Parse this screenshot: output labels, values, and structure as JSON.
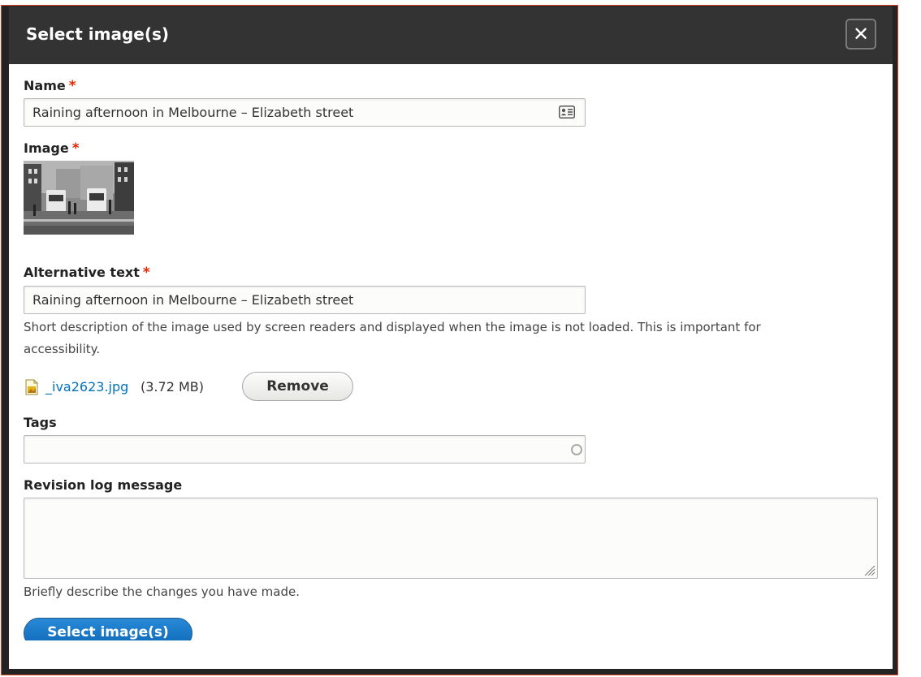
{
  "dialog": {
    "title": "Select image(s)",
    "close_label": "✕"
  },
  "form": {
    "name": {
      "label": "Name",
      "required_marker": "*",
      "value": "Raining afternoon in Melbourne – Elizabeth street"
    },
    "image": {
      "label": "Image",
      "required_marker": "*"
    },
    "alt_text": {
      "label": "Alternative text",
      "required_marker": "*",
      "value": "Raining afternoon in Melbourne – Elizabeth street",
      "description_line1": "Short description of the image used by screen readers and displayed when the image is not loaded. This is important for",
      "description_line2": "accessibility."
    },
    "file": {
      "name": "_iva2623.jpg",
      "size": "(3.72 MB)",
      "remove_label": "Remove"
    },
    "tags": {
      "label": "Tags",
      "value": ""
    },
    "revision": {
      "label": "Revision log message",
      "value": "",
      "description": "Briefly describe the changes you have made."
    },
    "submit_label": "Select image(s)"
  },
  "colors": {
    "titlebar": "#333333",
    "required": "#e62600",
    "link": "#0074bd",
    "primary_button": "#0a67b5"
  },
  "icons": {
    "close": "close-icon",
    "name_field": "contact-card-icon",
    "file": "image-file-icon",
    "tags_field": "autocomplete-throbber-icon",
    "textarea": "resize-grip-icon"
  }
}
